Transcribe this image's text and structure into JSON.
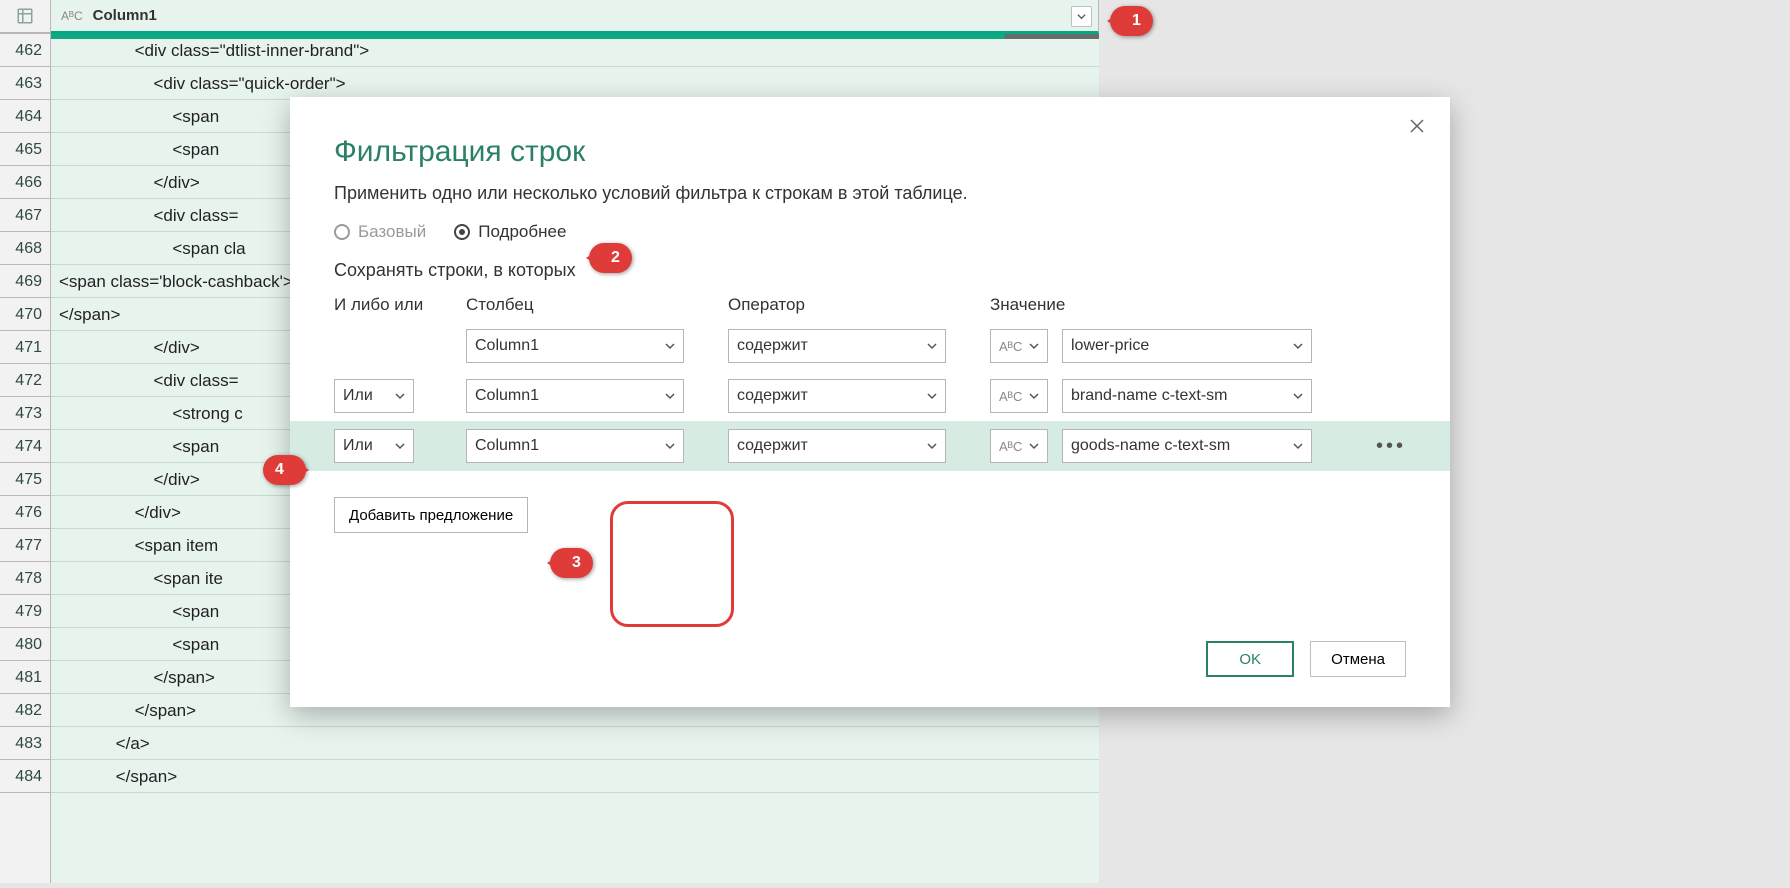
{
  "column": {
    "type_icon": "AᴮC",
    "name": "Column1"
  },
  "rows": [
    {
      "n": 462,
      "text": "                <div class=\"dtlist-inner-brand\">"
    },
    {
      "n": 463,
      "text": "                    <div class=\"quick-order\">"
    },
    {
      "n": 464,
      "text": "                        <span"
    },
    {
      "n": 465,
      "text": "                        <span"
    },
    {
      "n": 466,
      "text": "                    </div>"
    },
    {
      "n": 467,
      "text": "                    <div class="
    },
    {
      "n": 468,
      "text": "                        <span cla"
    },
    {
      "n": 469,
      "text": "<span class='block-cashback'>"
    },
    {
      "n": 470,
      "text": "</span>"
    },
    {
      "n": 471,
      "text": "                    </div>"
    },
    {
      "n": 472,
      "text": "                    <div class="
    },
    {
      "n": 473,
      "text": "                        <strong c"
    },
    {
      "n": 474,
      "text": "                        <span"
    },
    {
      "n": 475,
      "text": "                    </div>"
    },
    {
      "n": 476,
      "text": "                </div>"
    },
    {
      "n": 477,
      "text": "                <span item"
    },
    {
      "n": 478,
      "text": "                    <span ite"
    },
    {
      "n": 479,
      "text": "                        <span"
    },
    {
      "n": 480,
      "text": "                        <span"
    },
    {
      "n": 481,
      "text": "                    </span>"
    },
    {
      "n": 482,
      "text": "                </span>"
    },
    {
      "n": 483,
      "text": "            </a>"
    },
    {
      "n": 484,
      "text": "            </span>"
    }
  ],
  "dialog": {
    "title": "Фильтрация строк",
    "subtitle": "Применить одно или несколько условий фильтра к строкам в этой таблице.",
    "radio_basic": "Базовый",
    "radio_advanced": "Подробнее",
    "keep_rows": "Сохранять строки, в которых",
    "headers": {
      "andor": "И либо или",
      "column": "Столбец",
      "operator": "Оператор",
      "value": "Значение"
    },
    "type_icon": "AᴮC",
    "conditions": [
      {
        "andor": "",
        "column": "Column1",
        "operator": "содержит",
        "value": "lower-price"
      },
      {
        "andor": "Или",
        "column": "Column1",
        "operator": "содержит",
        "value": "brand-name c-text-sm"
      },
      {
        "andor": "Или",
        "column": "Column1",
        "operator": "содержит",
        "value": "goods-name c-text-sm"
      }
    ],
    "add_clause": "Добавить предложение",
    "ok": "OK",
    "cancel": "Отмена"
  },
  "badges": {
    "b1": "1",
    "b2": "2",
    "b3": "3",
    "b4": "4"
  }
}
